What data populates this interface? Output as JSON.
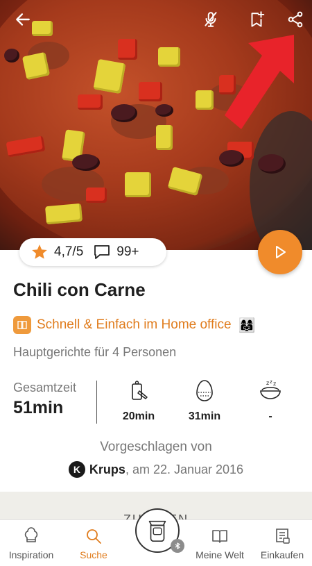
{
  "recipe": {
    "rating": "4,7/5",
    "comments": "99+",
    "title": "Chili con Carne",
    "category": "Schnell & Einfach im Home office",
    "category_emoji": "👩‍👩‍👧",
    "subtitle": "Hauptgerichte für 4 Personen",
    "total_time_label": "Gesamtzeit",
    "total_time_value": "51min",
    "prep_time": "20min",
    "cook_time": "31min",
    "rest_time": "-",
    "suggested_label": "Vorgeschlagen von",
    "author_initial": "K",
    "author_name": "Krups",
    "author_date": ", am 22. Januar 2016",
    "ingredients_tab": "ZUTATEN"
  },
  "bottom_nav": {
    "items": [
      {
        "label": "Inspiration",
        "icon": "chef-hat-icon"
      },
      {
        "label": "Suche",
        "icon": "search-icon"
      },
      {
        "label": "Meine Welt",
        "icon": "book-icon"
      },
      {
        "label": "Einkaufen",
        "icon": "shopping-list-icon"
      }
    ],
    "center_icon": "cooking-machine-icon",
    "badge_icon": "bluetooth-icon"
  },
  "colors": {
    "accent": "#f08b2b",
    "text_accent": "#e07c1d",
    "arrow": "#e8232a"
  }
}
